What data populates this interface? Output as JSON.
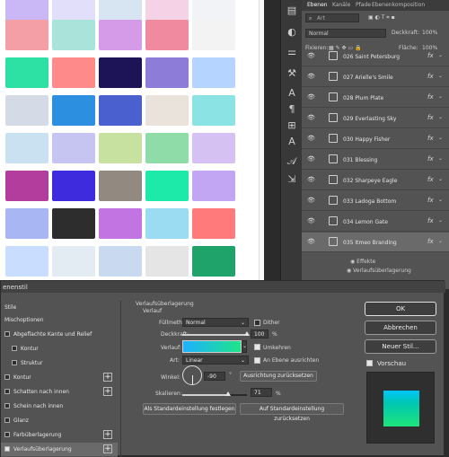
{
  "canvas": {
    "swatches": [
      [
        "#c9b8f5",
        "#e2dffa",
        "#d7e5f2",
        "#f6d2e6",
        "#f1f3f7"
      ],
      [
        "#f39fa5",
        "#a9e3d9",
        "#d69be8",
        "#f08a9f",
        "#f3f3f3"
      ],
      [
        "#2de0a3",
        "#ff8a8a",
        "#1c1457",
        "#8d7dd9",
        "#b5d4ff"
      ],
      [
        "#d5dbe6",
        "#2c8fe0",
        "#4a60cf",
        "#e9e3db",
        "#8be3e3"
      ],
      [
        "#c9e1f0",
        "#c6c4f0",
        "#c7e2a0",
        "#8fdca8",
        "#d5c1f2"
      ],
      [
        "#b33d9c",
        "#3f2bde",
        "#928a80",
        "#1de9a8",
        "#c2a6f3"
      ],
      [
        "#a9b6f4",
        "#2d2d2d",
        "#c274e2",
        "#9bdcf3",
        "#ff7b7b"
      ],
      [
        "#c8ddff",
        "#e3ebf3",
        "#c8d9f0",
        "#e5e5e5",
        "#1fa36b"
      ]
    ]
  },
  "layers_panel": {
    "tabs": [
      "Ebenen",
      "Kanäle",
      "Pfade",
      "Ebenenkomposition"
    ],
    "search_placeholder": "Art",
    "blend_mode": "Normal",
    "opacity_label": "Deckkraft:",
    "opacity_value": "100%",
    "lock_label": "Fixieren:",
    "fill_label": "Fläche:",
    "fill_value": "100%",
    "rows": [
      {
        "name": "026 Saint Petersburg",
        "fx": true
      },
      {
        "name": "027 Arielle's Smile",
        "fx": true
      },
      {
        "name": "028 Plum Plate",
        "fx": true
      },
      {
        "name": "029 Everlasting Sky",
        "fx": true
      },
      {
        "name": "030 Happy Fisher",
        "fx": true
      },
      {
        "name": "031 Blessing",
        "fx": true
      },
      {
        "name": "032 Sharpeye Eagle",
        "fx": true
      },
      {
        "name": "033 Ladoga Bottom",
        "fx": true
      },
      {
        "name": "034 Lemon Gate",
        "fx": true
      },
      {
        "name": "035 Itmeo Branding",
        "fx": true
      }
    ],
    "effects_label": "Effekte",
    "effect_item": "Verlaufsüberlagerung"
  },
  "dialog": {
    "title": "enenstil",
    "styles_header": "Stile",
    "styles": [
      {
        "label": "Mischoptionen",
        "checkbox": false,
        "plus": false
      },
      {
        "label": "Abgeflachte Kante und Relief",
        "checkbox": true,
        "checked": false,
        "plus": false
      },
      {
        "label": "Kontur",
        "checkbox": true,
        "checked": false,
        "plus": false,
        "indent": true
      },
      {
        "label": "Struktur",
        "checkbox": true,
        "checked": false,
        "plus": false,
        "indent": true
      },
      {
        "label": "Kontur",
        "checkbox": true,
        "checked": false,
        "plus": true
      },
      {
        "label": "Schatten nach innen",
        "checkbox": true,
        "checked": false,
        "plus": true
      },
      {
        "label": "Schein nach innen",
        "checkbox": true,
        "checked": false,
        "plus": false
      },
      {
        "label": "Glanz",
        "checkbox": true,
        "checked": false,
        "plus": false
      },
      {
        "label": "Farbüberlagerung",
        "checkbox": true,
        "checked": false,
        "plus": true
      },
      {
        "label": "Verlaufsüberlagerung",
        "checkbox": true,
        "checked": true,
        "plus": true
      }
    ],
    "section_title": "Verlaufsüberlagerung",
    "section_sub": "Verlauf",
    "blend_label": "Füllmethode:",
    "blend_value": "Normal",
    "dither_label": "Dither",
    "opacity_label": "Deckkraft:",
    "opacity_value": "100",
    "opacity_unit": "%",
    "opacity_fraction": 1.0,
    "gradient_label": "Verlauf:",
    "reverse_label": "Umkehren",
    "style_label": "Art:",
    "style_value": "Linear",
    "align_label": "An Ebene ausrichten",
    "angle_label": "Winkel:",
    "angle_value": "-90",
    "angle_unit": "°",
    "reset_align_label": "Ausrichtung zurücksetzen",
    "scale_label": "Skalieren:",
    "scale_value": "71",
    "scale_unit": "%",
    "scale_fraction": 0.71,
    "set_default_label": "Als Standardeinstellung festlegen",
    "reset_default_label": "Auf Standardeinstellung zurücksetzen",
    "ok_label": "OK",
    "cancel_label": "Abbrechen",
    "new_style_label": "Neuer Stil...",
    "preview_label": "Vorschau"
  },
  "colors": {
    "gradient_start": "#1fb0ff",
    "gradient_end": "#1de589",
    "panel_bg": "#535353"
  }
}
